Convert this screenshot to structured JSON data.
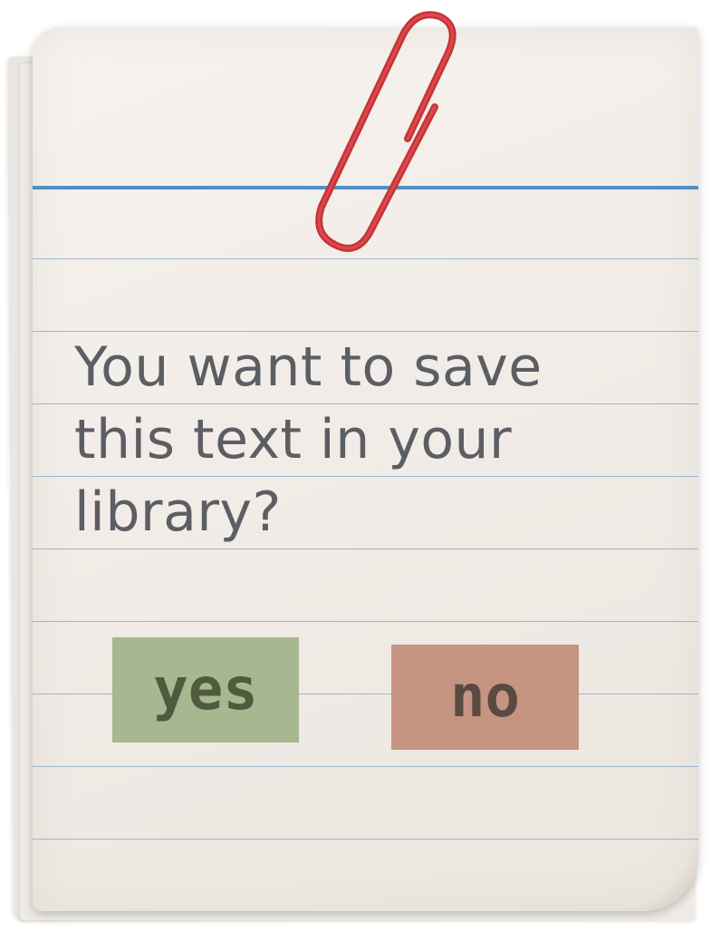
{
  "dialog": {
    "message": "You want to save this text in your library?",
    "yes_label": "yes",
    "no_label": "no"
  },
  "colors": {
    "paper": "#f1ece7",
    "rule_lines": "#9fb5cc",
    "margin_top_line": "#4f8fc6",
    "paper_clip": "#d6373b",
    "yes_button": "#a5b88f",
    "no_button": "#c59582",
    "message_text": "#5b5e63"
  },
  "icons": {
    "clip": "paper-clip-icon"
  }
}
